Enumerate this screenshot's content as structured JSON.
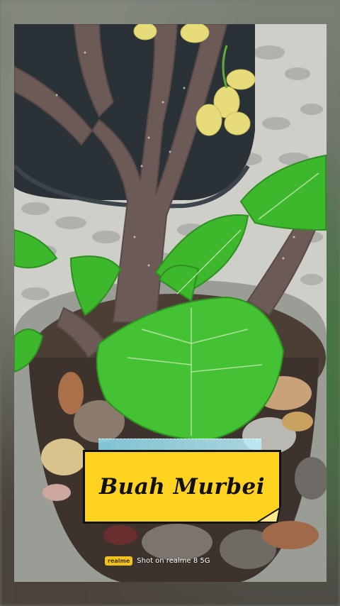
{
  "caption": {
    "title": "Buah Murbei"
  },
  "watermark": {
    "badge": "realme",
    "text": "Shot on realme 8 5G"
  },
  "colors": {
    "caption_bg": "#ffd31f",
    "leaf": "#3db82c",
    "branch": "#6b5a55",
    "pot": "#9a9c96"
  },
  "scene": {
    "subject": "mulberry-tree-in-pot",
    "elements": [
      "tree-trunk",
      "leaves",
      "mulberry-fruit",
      "pot",
      "tiled-floor",
      "dry-leaves"
    ]
  }
}
